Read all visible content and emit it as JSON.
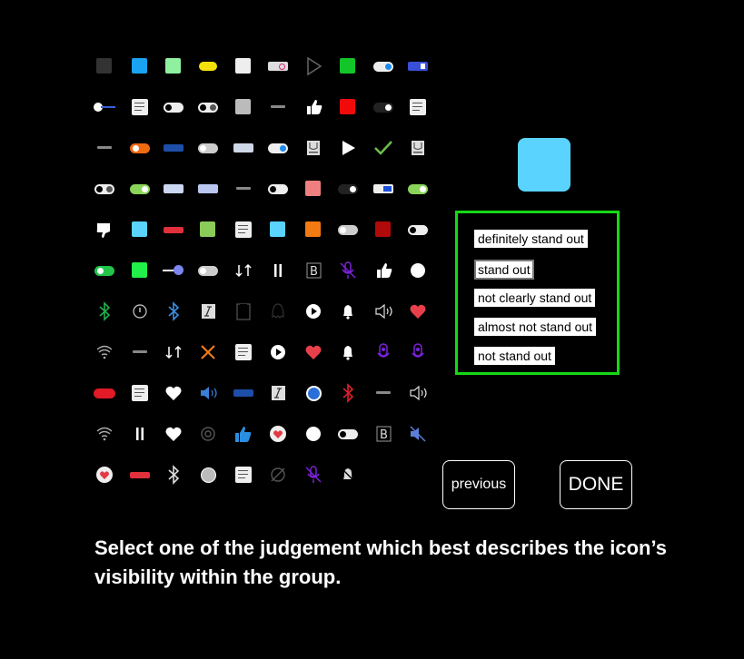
{
  "options": [
    {
      "label": "definitely stand out",
      "selected": false
    },
    {
      "label": "stand out",
      "selected": true
    },
    {
      "label": "not clearly stand out",
      "selected": false
    },
    {
      "label": "almost not stand out",
      "selected": false
    },
    {
      "label": "not stand out",
      "selected": false
    }
  ],
  "buttons": {
    "previous": "previous",
    "done": "DONE"
  },
  "instruction": "Select one of the judgement which best describes the icon’s visibility within the group.",
  "preview_color": "#5ad3ff",
  "option_border_color": "#16d816",
  "icons": [
    [
      "square-dark",
      "square-blue",
      "square-mint",
      "pill-yellow",
      "square-white",
      "pill-pink-knob",
      "play-outline-icon",
      "square-green",
      "toggle-blue-on",
      "toggle-blue-rect"
    ],
    [
      "slider-knob",
      "document-icon",
      "toggle-white",
      "toggle-white-off",
      "square-gray",
      "label-tiny",
      "thumbs-up-icon",
      "square-red",
      "toggle-dark",
      "document-icon"
    ],
    [
      "label-tiny",
      "toggle-orange",
      "pill-blue-label",
      "toggle-gray",
      "pill-light-rect",
      "toggle-blue-on",
      "cup-icon",
      "play-white-icon",
      "checkmark-icon",
      "cup-icon"
    ],
    [
      "toggle-white-off",
      "toggle-lime",
      "pill-rect-blue",
      "pill-rect-gray",
      "label-tiny",
      "toggle-white",
      "square-salmon",
      "toggle-dark",
      "pill-blue-rect",
      "toggle-lime"
    ],
    [
      "thumbs-down-icon",
      "square-sky",
      "pill-red-label",
      "square-lime",
      "document-icon",
      "square-sky",
      "square-orange",
      "toggle-gray",
      "square-darkred",
      "toggle-white"
    ],
    [
      "toggle-green",
      "square-brightgreen",
      "slider-purple",
      "toggle-gray",
      "refresh-icon",
      "pause-icon",
      "bold-b-icon",
      "mic-off-icon",
      "thumbs-up-icon",
      "circle-white"
    ],
    [
      "bluetooth-green-icon",
      "timer-icon",
      "bluetooth-blue-icon",
      "italic-icon",
      "frame-icon",
      "snapchat-icon",
      "play-circle-icon",
      "bell-icon",
      "speaker-icon",
      "heart-red-icon"
    ],
    [
      "wifi-icon",
      "label-tiny",
      "refresh-icon",
      "close-orange-icon",
      "document-icon",
      "play-circle-icon",
      "heart-red-icon",
      "bell-icon",
      "mic-purple-icon",
      "mic-purple-icon"
    ],
    [
      "save-red-pill",
      "document-icon",
      "heart-white-icon",
      "speaker-blue-icon",
      "pill-blue-label",
      "italic-icon",
      "circle-blue",
      "bluetooth-red-icon",
      "label-tiny",
      "speaker-icon"
    ],
    [
      "wifi-icon",
      "pause-icon",
      "heart-white-icon",
      "eye-icon",
      "thumbs-blue-icon",
      "heart-circle-icon",
      "circle-white",
      "toggle-white",
      "bold-b-icon",
      "speaker-off-icon"
    ],
    [
      "heart-circle-icon",
      "pill-red-label",
      "bluetooth-white-icon",
      "circle-gray",
      "document-icon",
      "eye-off-icon",
      "mic-off-icon",
      "bell-off-icon",
      null,
      null
    ]
  ]
}
